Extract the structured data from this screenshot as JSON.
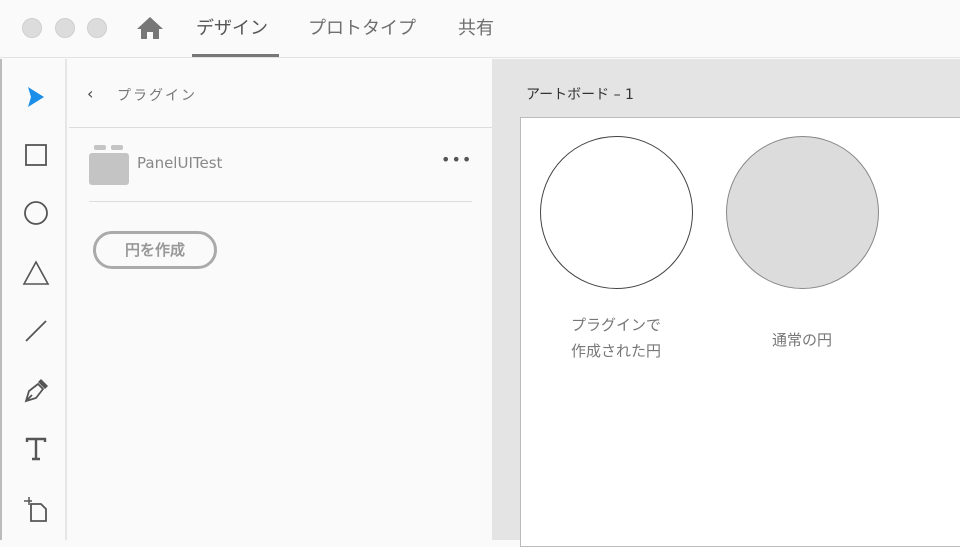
{
  "titlebar": {
    "tabs": [
      {
        "label": "デザイン"
      },
      {
        "label": "プロトタイプ"
      },
      {
        "label": "共有"
      }
    ]
  },
  "panel": {
    "back_title": "プラグイン",
    "plugin_name": "PanelUITest",
    "more": "•••",
    "create_button": "円を作成"
  },
  "canvas": {
    "artboard_title": "アートボード – 1",
    "circle1_label": "プラグインで\n作成された円",
    "circle2_label": "通常の円"
  },
  "colors": {
    "accent": "#1a8ee8"
  }
}
